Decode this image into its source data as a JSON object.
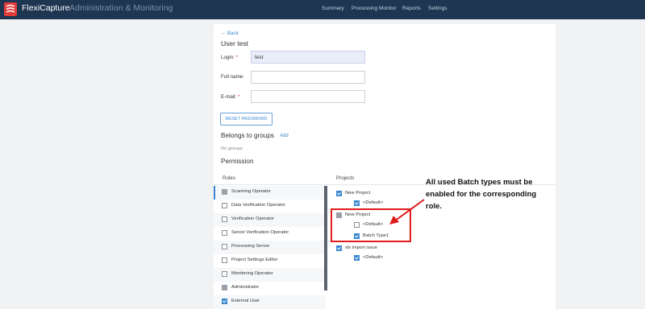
{
  "header": {
    "brand": "FlexiCapture",
    "subtitle": "Administration & Monitoring",
    "nav": [
      "Summary",
      "Processing Monitor",
      "Reports",
      "Settings"
    ]
  },
  "page": {
    "back_label": "← Back",
    "title": "User test"
  },
  "form": {
    "login_label": "Login:",
    "login_value": "test",
    "fullname_label": "Full name:",
    "fullname_value": "",
    "email_label": "E-mail:",
    "email_value": "",
    "required_mark": "*"
  },
  "reset_button": "RESET PASSWORD",
  "groups": {
    "heading": "Belongs to groups",
    "add_label": "Add",
    "empty_text": "No groups"
  },
  "permission": {
    "heading": "Permission",
    "roles_header": "Roles",
    "projects_header": "Projects",
    "roles": [
      {
        "label": "Scanning Operator",
        "state": "grey"
      },
      {
        "label": "Data Verification Operator",
        "state": "off"
      },
      {
        "label": "Verification Operator",
        "state": "off"
      },
      {
        "label": "Senior Verification Operator",
        "state": "off"
      },
      {
        "label": "Processing Server",
        "state": "off"
      },
      {
        "label": "Project Settings Editor",
        "state": "off"
      },
      {
        "label": "Monitoring Operator",
        "state": "off"
      },
      {
        "label": "Administrator",
        "state": "grey"
      },
      {
        "label": "External User",
        "state": "on"
      }
    ],
    "projects": [
      {
        "label": "New Project",
        "state": "on",
        "level": 0
      },
      {
        "label": "<Default>",
        "state": "on",
        "level": 1
      },
      {
        "label": "New Project",
        "state": "grey",
        "level": 0
      },
      {
        "label": "<Default>",
        "state": "off",
        "level": 1
      },
      {
        "label": "Batch Type1",
        "state": "on",
        "level": 1
      },
      {
        "label": "xls import issue",
        "state": "on",
        "level": 0
      },
      {
        "label": "<Default>",
        "state": "on",
        "level": 1
      }
    ]
  },
  "annotation": {
    "text": "All used Batch types must be enabled for the corresponding role.",
    "color": "#e01b1b"
  }
}
